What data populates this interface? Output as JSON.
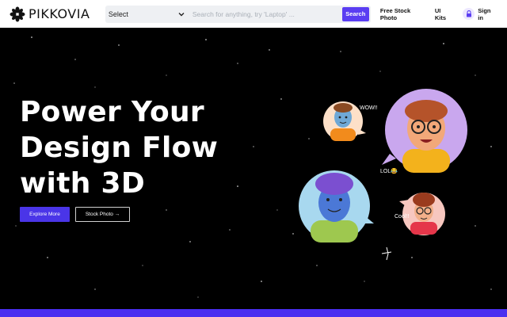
{
  "header": {
    "logo_text": "PIKKOVIA",
    "search": {
      "category": "Select",
      "placeholder": "Search for anything, try 'Laptop' ...",
      "button_label": "Search"
    },
    "nav": [
      "Free Stock Photo",
      "UI Kits"
    ],
    "signin_label": "Sign in"
  },
  "hero": {
    "title_lines": [
      "Power Your",
      "Design Flow",
      "with 3D"
    ],
    "primary_button": "Explore More",
    "secondary_button": "Stock Photo →",
    "bubbles": {
      "wow": "WOW!!",
      "lol": "LOL😂",
      "cool": "Cool!!"
    }
  },
  "colors": {
    "accent": "#5a3df2",
    "hero_bg": "#000000",
    "bottom_strip": "#4a2ff0"
  },
  "icons": [
    "flower-logo-icon",
    "chevron-down-icon",
    "lock-icon",
    "sparkle-icon"
  ]
}
